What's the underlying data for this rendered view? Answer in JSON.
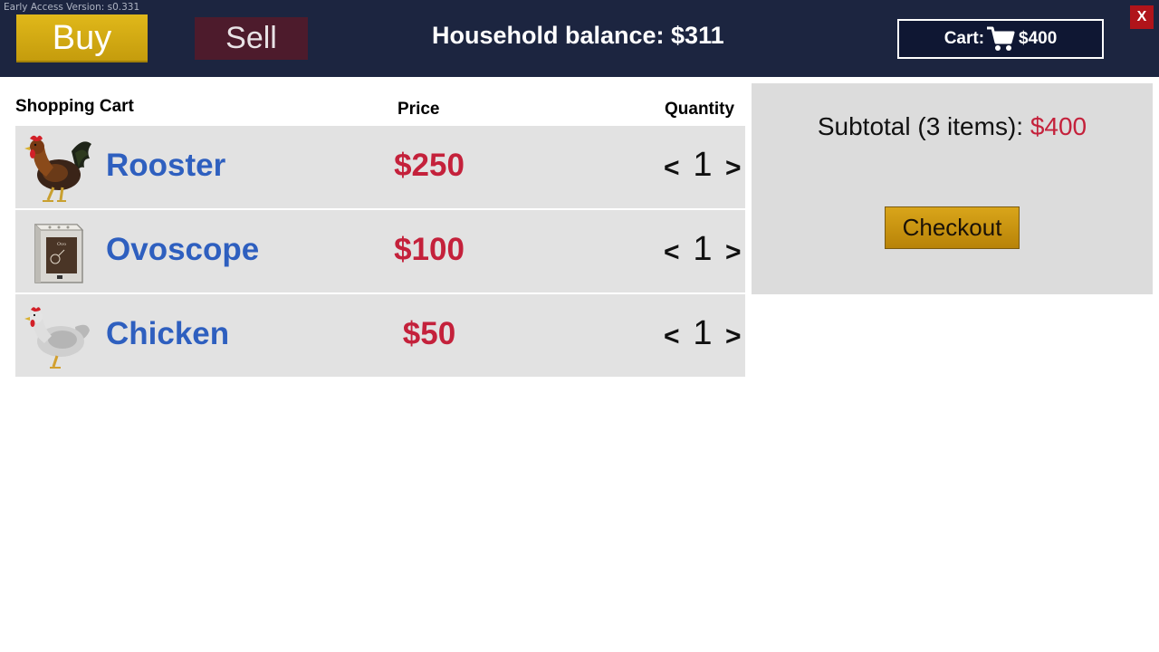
{
  "header": {
    "version": "Early Access Version: s0.331",
    "tabs": {
      "buy": "Buy",
      "sell": "Sell"
    },
    "balance": "Household balance: $311",
    "cart_label": "Cart:",
    "cart_total": "$400",
    "close_label": "X",
    "colors": {
      "bar": "#1c2540",
      "buy_tab": "#d4ab12",
      "sell_tab": "#4d1b2c",
      "close": "#b0141a"
    }
  },
  "cart": {
    "title": "Shopping Cart",
    "price_header": "Price",
    "quantity_header": "Quantity",
    "dec_label": "<",
    "inc_label": ">",
    "items": [
      {
        "name": "Rooster",
        "price": "$250",
        "quantity": "1",
        "icon": "rooster-icon"
      },
      {
        "name": "Ovoscope",
        "price": "$100",
        "quantity": "1",
        "icon": "ovoscope-icon"
      },
      {
        "name": "Chicken",
        "price": "$50",
        "quantity": "1",
        "icon": "chicken-icon"
      }
    ],
    "colors": {
      "name": "#2e5fbf",
      "price": "#c4213b"
    }
  },
  "summary": {
    "subtotal_label": "Subtotal (3 items): ",
    "subtotal_value": "$400",
    "checkout_label": "Checkout"
  }
}
